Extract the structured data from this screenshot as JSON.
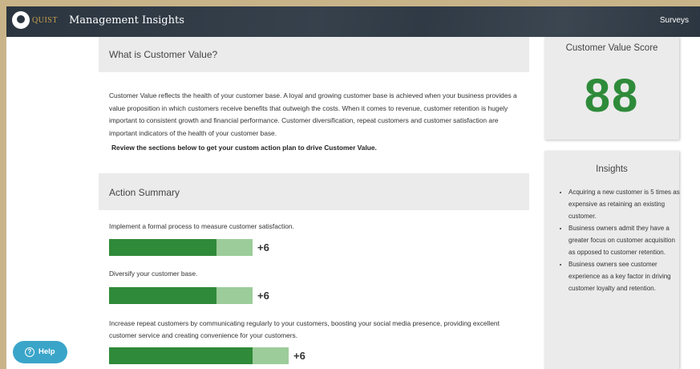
{
  "topbar": {
    "logo_text": "QUIST",
    "title": "Management Insights",
    "nav_surveys": "Surveys"
  },
  "customer_value": {
    "heading": "What is Customer Value?",
    "description": "Customer Value reflects the health of your customer base. A loyal and growing customer base is achieved when your business provides a value proposition in which customers receive benefits that outweigh the costs. When it comes to revenue, customer retention is hugely important to consistent growth and financial performance. Customer diversification, repeat customers and customer satisfaction are important indicators of the health of your customer base.",
    "cta": "Review the sections below to get your custom action plan to drive Customer Value."
  },
  "action_summary": {
    "heading": "Action Summary",
    "items": [
      {
        "label": "Implement a formal process to measure customer satisfaction.",
        "value": "+6",
        "progress": 0.75
      },
      {
        "label": "Diversify your customer base.",
        "value": "+6",
        "progress": 0.75
      },
      {
        "label": "Increase repeat customers by communicating regularly to your customers, boosting your social media presence, providing excellent customer service and creating convenience for your customers.",
        "value": "+6",
        "progress": 0.8
      }
    ]
  },
  "score": {
    "title": "Customer Value Score",
    "value": "88",
    "color": "#2e8b3a"
  },
  "insights": {
    "title": "Insights",
    "items": [
      "Acquiring a new customer is 5 times as expensive as retaining an existing customer.",
      "Business owners admit they have a greater focus on customer acquisition as opposed to customer retention.",
      "Business owners see customer experience as a key factor in driving customer loyalty and retention."
    ]
  },
  "help": {
    "icon": "question-circle-icon",
    "label": "Help"
  },
  "colors": {
    "topbar": "#2b3540",
    "bar_fill": "#2f8a39",
    "bar_track": "#9ccc9a",
    "help_button": "#3aa5c9",
    "card_bg": "#ebebeb"
  }
}
